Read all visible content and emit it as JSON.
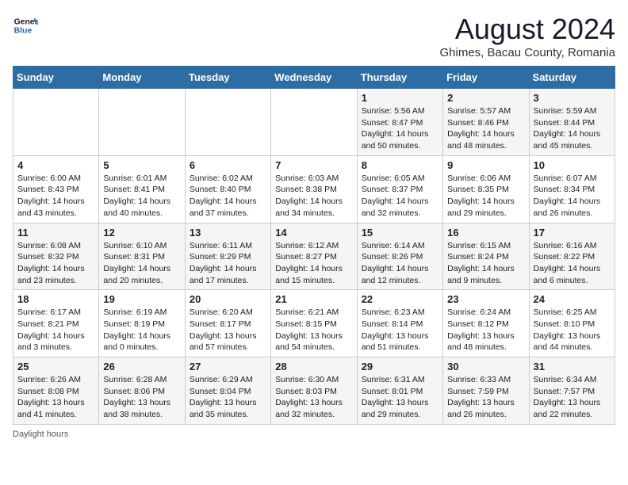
{
  "logo": {
    "line1": "General",
    "line2": "Blue"
  },
  "title": "August 2024",
  "location": "Ghimes, Bacau County, Romania",
  "days_of_week": [
    "Sunday",
    "Monday",
    "Tuesday",
    "Wednesday",
    "Thursday",
    "Friday",
    "Saturday"
  ],
  "weeks": [
    [
      {
        "day": "",
        "info": ""
      },
      {
        "day": "",
        "info": ""
      },
      {
        "day": "",
        "info": ""
      },
      {
        "day": "",
        "info": ""
      },
      {
        "day": "1",
        "info": "Sunrise: 5:56 AM\nSunset: 8:47 PM\nDaylight: 14 hours\nand 50 minutes."
      },
      {
        "day": "2",
        "info": "Sunrise: 5:57 AM\nSunset: 8:46 PM\nDaylight: 14 hours\nand 48 minutes."
      },
      {
        "day": "3",
        "info": "Sunrise: 5:59 AM\nSunset: 8:44 PM\nDaylight: 14 hours\nand 45 minutes."
      }
    ],
    [
      {
        "day": "4",
        "info": "Sunrise: 6:00 AM\nSunset: 8:43 PM\nDaylight: 14 hours\nand 43 minutes."
      },
      {
        "day": "5",
        "info": "Sunrise: 6:01 AM\nSunset: 8:41 PM\nDaylight: 14 hours\nand 40 minutes."
      },
      {
        "day": "6",
        "info": "Sunrise: 6:02 AM\nSunset: 8:40 PM\nDaylight: 14 hours\nand 37 minutes."
      },
      {
        "day": "7",
        "info": "Sunrise: 6:03 AM\nSunset: 8:38 PM\nDaylight: 14 hours\nand 34 minutes."
      },
      {
        "day": "8",
        "info": "Sunrise: 6:05 AM\nSunset: 8:37 PM\nDaylight: 14 hours\nand 32 minutes."
      },
      {
        "day": "9",
        "info": "Sunrise: 6:06 AM\nSunset: 8:35 PM\nDaylight: 14 hours\nand 29 minutes."
      },
      {
        "day": "10",
        "info": "Sunrise: 6:07 AM\nSunset: 8:34 PM\nDaylight: 14 hours\nand 26 minutes."
      }
    ],
    [
      {
        "day": "11",
        "info": "Sunrise: 6:08 AM\nSunset: 8:32 PM\nDaylight: 14 hours\nand 23 minutes."
      },
      {
        "day": "12",
        "info": "Sunrise: 6:10 AM\nSunset: 8:31 PM\nDaylight: 14 hours\nand 20 minutes."
      },
      {
        "day": "13",
        "info": "Sunrise: 6:11 AM\nSunset: 8:29 PM\nDaylight: 14 hours\nand 17 minutes."
      },
      {
        "day": "14",
        "info": "Sunrise: 6:12 AM\nSunset: 8:27 PM\nDaylight: 14 hours\nand 15 minutes."
      },
      {
        "day": "15",
        "info": "Sunrise: 6:14 AM\nSunset: 8:26 PM\nDaylight: 14 hours\nand 12 minutes."
      },
      {
        "day": "16",
        "info": "Sunrise: 6:15 AM\nSunset: 8:24 PM\nDaylight: 14 hours\nand 9 minutes."
      },
      {
        "day": "17",
        "info": "Sunrise: 6:16 AM\nSunset: 8:22 PM\nDaylight: 14 hours\nand 6 minutes."
      }
    ],
    [
      {
        "day": "18",
        "info": "Sunrise: 6:17 AM\nSunset: 8:21 PM\nDaylight: 14 hours\nand 3 minutes."
      },
      {
        "day": "19",
        "info": "Sunrise: 6:19 AM\nSunset: 8:19 PM\nDaylight: 14 hours\nand 0 minutes."
      },
      {
        "day": "20",
        "info": "Sunrise: 6:20 AM\nSunset: 8:17 PM\nDaylight: 13 hours\nand 57 minutes."
      },
      {
        "day": "21",
        "info": "Sunrise: 6:21 AM\nSunset: 8:15 PM\nDaylight: 13 hours\nand 54 minutes."
      },
      {
        "day": "22",
        "info": "Sunrise: 6:23 AM\nSunset: 8:14 PM\nDaylight: 13 hours\nand 51 minutes."
      },
      {
        "day": "23",
        "info": "Sunrise: 6:24 AM\nSunset: 8:12 PM\nDaylight: 13 hours\nand 48 minutes."
      },
      {
        "day": "24",
        "info": "Sunrise: 6:25 AM\nSunset: 8:10 PM\nDaylight: 13 hours\nand 44 minutes."
      }
    ],
    [
      {
        "day": "25",
        "info": "Sunrise: 6:26 AM\nSunset: 8:08 PM\nDaylight: 13 hours\nand 41 minutes."
      },
      {
        "day": "26",
        "info": "Sunrise: 6:28 AM\nSunset: 8:06 PM\nDaylight: 13 hours\nand 38 minutes."
      },
      {
        "day": "27",
        "info": "Sunrise: 6:29 AM\nSunset: 8:04 PM\nDaylight: 13 hours\nand 35 minutes."
      },
      {
        "day": "28",
        "info": "Sunrise: 6:30 AM\nSunset: 8:03 PM\nDaylight: 13 hours\nand 32 minutes."
      },
      {
        "day": "29",
        "info": "Sunrise: 6:31 AM\nSunset: 8:01 PM\nDaylight: 13 hours\nand 29 minutes."
      },
      {
        "day": "30",
        "info": "Sunrise: 6:33 AM\nSunset: 7:59 PM\nDaylight: 13 hours\nand 26 minutes."
      },
      {
        "day": "31",
        "info": "Sunrise: 6:34 AM\nSunset: 7:57 PM\nDaylight: 13 hours\nand 22 minutes."
      }
    ]
  ],
  "footer": "Daylight hours"
}
